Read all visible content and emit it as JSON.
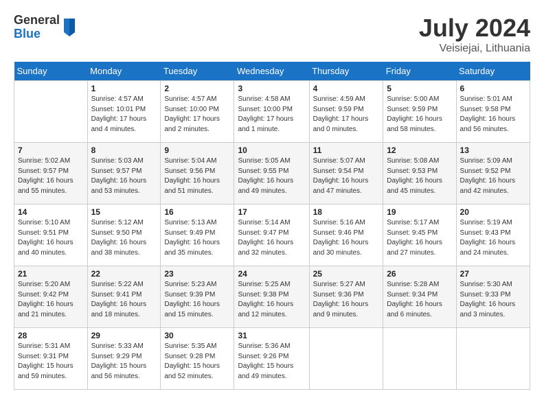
{
  "header": {
    "logo_general": "General",
    "logo_blue": "Blue",
    "month_title": "July 2024",
    "location": "Veisiejai, Lithuania"
  },
  "days_of_week": [
    "Sunday",
    "Monday",
    "Tuesday",
    "Wednesday",
    "Thursday",
    "Friday",
    "Saturday"
  ],
  "weeks": [
    [
      {
        "day": "",
        "info": ""
      },
      {
        "day": "1",
        "info": "Sunrise: 4:57 AM\nSunset: 10:01 PM\nDaylight: 17 hours\nand 4 minutes."
      },
      {
        "day": "2",
        "info": "Sunrise: 4:57 AM\nSunset: 10:00 PM\nDaylight: 17 hours\nand 2 minutes."
      },
      {
        "day": "3",
        "info": "Sunrise: 4:58 AM\nSunset: 10:00 PM\nDaylight: 17 hours\nand 1 minute."
      },
      {
        "day": "4",
        "info": "Sunrise: 4:59 AM\nSunset: 9:59 PM\nDaylight: 17 hours\nand 0 minutes."
      },
      {
        "day": "5",
        "info": "Sunrise: 5:00 AM\nSunset: 9:59 PM\nDaylight: 16 hours\nand 58 minutes."
      },
      {
        "day": "6",
        "info": "Sunrise: 5:01 AM\nSunset: 9:58 PM\nDaylight: 16 hours\nand 56 minutes."
      }
    ],
    [
      {
        "day": "7",
        "info": "Sunrise: 5:02 AM\nSunset: 9:57 PM\nDaylight: 16 hours\nand 55 minutes."
      },
      {
        "day": "8",
        "info": "Sunrise: 5:03 AM\nSunset: 9:57 PM\nDaylight: 16 hours\nand 53 minutes."
      },
      {
        "day": "9",
        "info": "Sunrise: 5:04 AM\nSunset: 9:56 PM\nDaylight: 16 hours\nand 51 minutes."
      },
      {
        "day": "10",
        "info": "Sunrise: 5:05 AM\nSunset: 9:55 PM\nDaylight: 16 hours\nand 49 minutes."
      },
      {
        "day": "11",
        "info": "Sunrise: 5:07 AM\nSunset: 9:54 PM\nDaylight: 16 hours\nand 47 minutes."
      },
      {
        "day": "12",
        "info": "Sunrise: 5:08 AM\nSunset: 9:53 PM\nDaylight: 16 hours\nand 45 minutes."
      },
      {
        "day": "13",
        "info": "Sunrise: 5:09 AM\nSunset: 9:52 PM\nDaylight: 16 hours\nand 42 minutes."
      }
    ],
    [
      {
        "day": "14",
        "info": "Sunrise: 5:10 AM\nSunset: 9:51 PM\nDaylight: 16 hours\nand 40 minutes."
      },
      {
        "day": "15",
        "info": "Sunrise: 5:12 AM\nSunset: 9:50 PM\nDaylight: 16 hours\nand 38 minutes."
      },
      {
        "day": "16",
        "info": "Sunrise: 5:13 AM\nSunset: 9:49 PM\nDaylight: 16 hours\nand 35 minutes."
      },
      {
        "day": "17",
        "info": "Sunrise: 5:14 AM\nSunset: 9:47 PM\nDaylight: 16 hours\nand 32 minutes."
      },
      {
        "day": "18",
        "info": "Sunrise: 5:16 AM\nSunset: 9:46 PM\nDaylight: 16 hours\nand 30 minutes."
      },
      {
        "day": "19",
        "info": "Sunrise: 5:17 AM\nSunset: 9:45 PM\nDaylight: 16 hours\nand 27 minutes."
      },
      {
        "day": "20",
        "info": "Sunrise: 5:19 AM\nSunset: 9:43 PM\nDaylight: 16 hours\nand 24 minutes."
      }
    ],
    [
      {
        "day": "21",
        "info": "Sunrise: 5:20 AM\nSunset: 9:42 PM\nDaylight: 16 hours\nand 21 minutes."
      },
      {
        "day": "22",
        "info": "Sunrise: 5:22 AM\nSunset: 9:41 PM\nDaylight: 16 hours\nand 18 minutes."
      },
      {
        "day": "23",
        "info": "Sunrise: 5:23 AM\nSunset: 9:39 PM\nDaylight: 16 hours\nand 15 minutes."
      },
      {
        "day": "24",
        "info": "Sunrise: 5:25 AM\nSunset: 9:38 PM\nDaylight: 16 hours\nand 12 minutes."
      },
      {
        "day": "25",
        "info": "Sunrise: 5:27 AM\nSunset: 9:36 PM\nDaylight: 16 hours\nand 9 minutes."
      },
      {
        "day": "26",
        "info": "Sunrise: 5:28 AM\nSunset: 9:34 PM\nDaylight: 16 hours\nand 6 minutes."
      },
      {
        "day": "27",
        "info": "Sunrise: 5:30 AM\nSunset: 9:33 PM\nDaylight: 16 hours\nand 3 minutes."
      }
    ],
    [
      {
        "day": "28",
        "info": "Sunrise: 5:31 AM\nSunset: 9:31 PM\nDaylight: 15 hours\nand 59 minutes."
      },
      {
        "day": "29",
        "info": "Sunrise: 5:33 AM\nSunset: 9:29 PM\nDaylight: 15 hours\nand 56 minutes."
      },
      {
        "day": "30",
        "info": "Sunrise: 5:35 AM\nSunset: 9:28 PM\nDaylight: 15 hours\nand 52 minutes."
      },
      {
        "day": "31",
        "info": "Sunrise: 5:36 AM\nSunset: 9:26 PM\nDaylight: 15 hours\nand 49 minutes."
      },
      {
        "day": "",
        "info": ""
      },
      {
        "day": "",
        "info": ""
      },
      {
        "day": "",
        "info": ""
      }
    ]
  ]
}
